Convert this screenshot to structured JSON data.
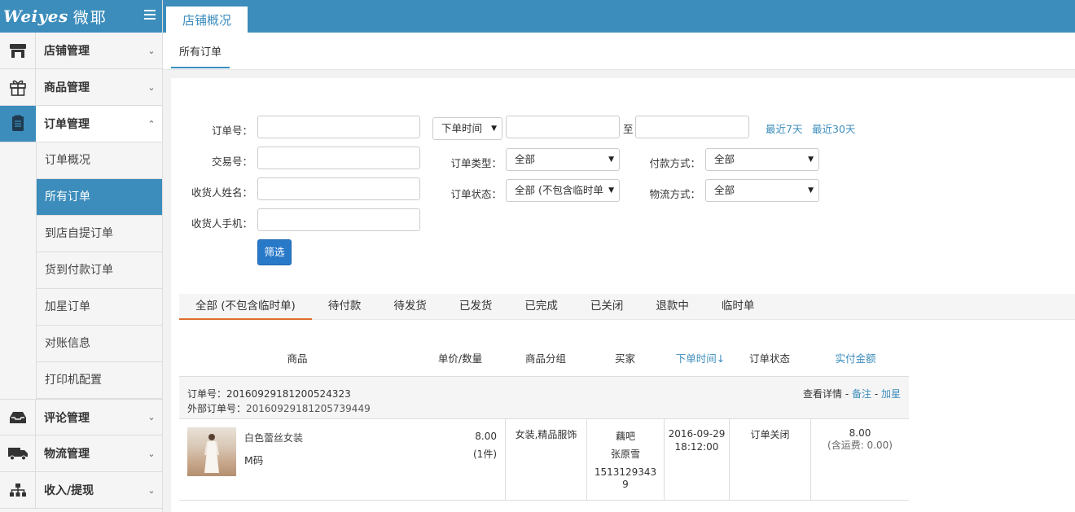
{
  "brand": {
    "logo": "Weiyes",
    "logo_cn": "微耶"
  },
  "sidebar": {
    "items": [
      {
        "label": "店铺管理",
        "icon": "store-icon"
      },
      {
        "label": "商品管理",
        "icon": "gift-icon"
      },
      {
        "label": "订单管理",
        "icon": "clipboard-icon"
      }
    ],
    "sub_items": [
      "订单概况",
      "所有订单",
      "到店自提订单",
      "货到付款订单",
      "加星订单",
      "对账信息",
      "打印机配置"
    ],
    "items_after": [
      {
        "label": "评论管理",
        "icon": "inbox-icon"
      },
      {
        "label": "物流管理",
        "icon": "truck-icon"
      },
      {
        "label": "收入/提现",
        "icon": "sitemap-icon"
      }
    ]
  },
  "topbar": {
    "tab": "店铺概况"
  },
  "subbar": {
    "tab": "所有订单"
  },
  "filters": {
    "order_no_label": "订单号：",
    "trade_no_label": "交易号：",
    "receiver_name_label": "收货人姓名：",
    "receiver_phone_label": "收货人手机：",
    "time_select": "下单时间",
    "to_label": "至",
    "last7": "最近7天",
    "last30": "最近30天",
    "order_type_label": "订单类型：",
    "order_type_value": "全部",
    "order_status_label": "订单状态：",
    "order_status_value": "全部 (不包含临时单",
    "pay_method_label": "付款方式：",
    "pay_method_value": "全部",
    "logistics_label": "物流方式：",
    "logistics_value": "全部",
    "filter_button": "筛选"
  },
  "status_tabs": [
    "全部 (不包含临时单)",
    "待付款",
    "待发货",
    "已发货",
    "已完成",
    "已关闭",
    "退款中",
    "临时单"
  ],
  "table": {
    "headers": {
      "product": "商品",
      "price_qty": "单价/数量",
      "category": "商品分组",
      "buyer": "买家",
      "order_time": "下单时间↓",
      "status": "订单状态",
      "amount": "实付金额"
    },
    "orders": [
      {
        "order_no_label": "订单号：",
        "order_no": "20160929181200524323",
        "ext_no_label": "外部订单号：",
        "ext_no": "20160929181205739449",
        "op_detail": "查看详情",
        "op_sep": " - ",
        "op_note": "备注",
        "op_star": "加星",
        "product_name": "白色蕾丝女装",
        "sku": "M码",
        "price": "8.00",
        "qty": "(1件)",
        "category": "女装,精品服饰",
        "buyer_nick": "藕吧",
        "buyer_name": "张原雪",
        "buyer_phone_1": "1513129343",
        "buyer_phone_2": "9",
        "date": "2016-09-29",
        "time": "18:12:00",
        "status": "订单关闭",
        "amount": "8.00",
        "shipping": "(含运费: 0.00)"
      }
    ]
  },
  "colors": {
    "primary": "#3c8dbc",
    "button": "#2979c9",
    "active_tab_underline": "#e06e2e"
  }
}
